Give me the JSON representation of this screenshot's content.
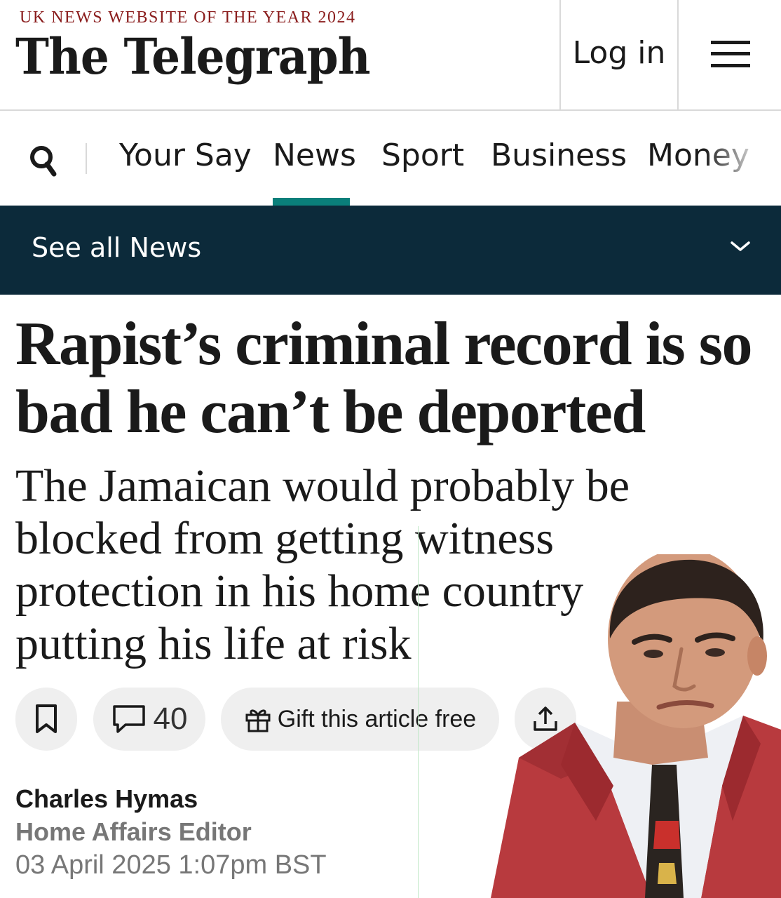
{
  "masthead": {
    "award": "UK NEWS WEBSITE OF THE YEAR 2024",
    "logo": "The Telegraph",
    "login_label": "Log in",
    "menu_icon": "hamburger-menu-icon"
  },
  "nav": {
    "search_icon": "search-icon",
    "items": [
      "Your Say",
      "News",
      "Sport",
      "Business",
      "Money"
    ],
    "active": "News"
  },
  "subnav": {
    "label": "See all News",
    "icon": "chevron-down-icon"
  },
  "article": {
    "headline": "Rapist’s criminal record is so bad he can’t be deported",
    "standfirst": "The Jamaican would probably be blocked from getting witness protection in his home country putting his life at risk",
    "actions": {
      "save_icon": "bookmark-icon",
      "comments_icon": "comment-icon",
      "comment_count": "40",
      "gift_icon": "gift-icon",
      "gift_label": "Gift this article free",
      "share_icon": "share-icon"
    },
    "byline": {
      "author": "Charles Hymas",
      "role": "Home Affairs Editor",
      "date": "03 April 2025 1:07pm BST"
    }
  },
  "colors": {
    "accent": "#0a7f7a",
    "subnav_bg": "#0c2a3a",
    "award_red": "#8a1c1c",
    "pill_bg": "#efefef",
    "meta_grey": "#777777"
  },
  "overlay": {
    "description_icon": "man-in-red-blazer-cutout"
  }
}
